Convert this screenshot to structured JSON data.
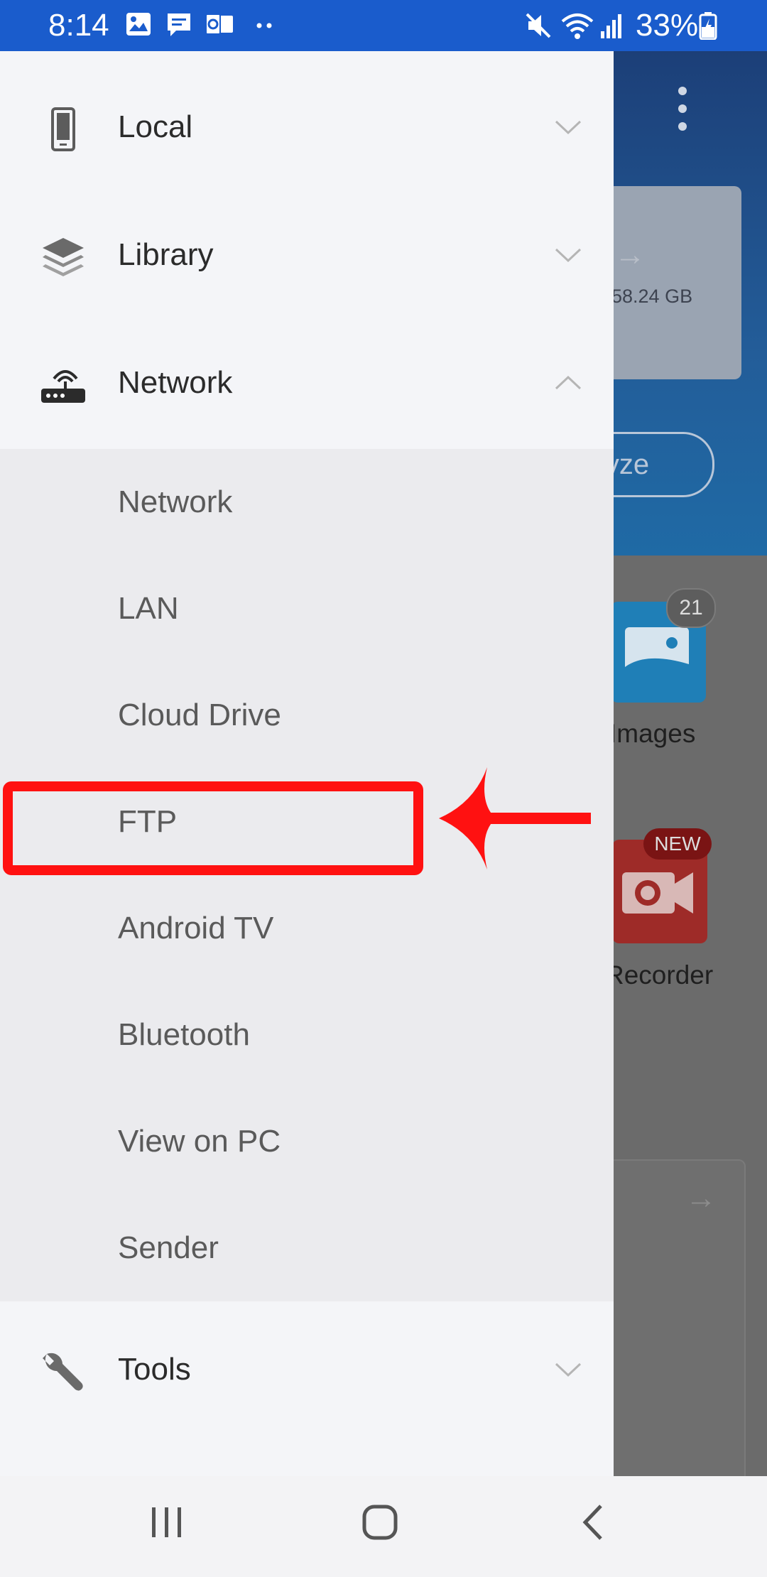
{
  "status_bar": {
    "time": "8:14",
    "battery": "33%",
    "icons": [
      "image-icon",
      "message-icon",
      "outlook-icon",
      "dots-icon",
      "mute-icon",
      "wifi-icon",
      "signal-icon",
      "battery-icon"
    ]
  },
  "drawer": {
    "items": [
      {
        "label": "Local",
        "icon": "phone-icon",
        "expanded": false
      },
      {
        "label": "Library",
        "icon": "layers-icon",
        "expanded": false
      },
      {
        "label": "Network",
        "icon": "router-icon",
        "expanded": true
      },
      {
        "label": "Tools",
        "icon": "wrench-icon",
        "expanded": false
      }
    ],
    "network_subitems": [
      "Network",
      "LAN",
      "Cloud Drive",
      "FTP",
      "Android TV",
      "Bluetooth",
      "View on PC",
      "Sender"
    ]
  },
  "annotation": {
    "highlight_target": "FTP",
    "color": "#ff1111"
  },
  "background_app": {
    "storage_text": "/ 58.24 GB",
    "analyze_button": "lyze",
    "images_badge": "21",
    "images_label": "Images",
    "new_badge": "NEW",
    "recorder_label": "Recorder"
  },
  "nav_bar": {
    "buttons": [
      "recents-icon",
      "home-icon",
      "back-icon"
    ]
  },
  "colors": {
    "status_bar": "#1a5ccc",
    "drawer_bg": "#f4f5f8",
    "submenu_bg": "#ebebee",
    "header_blue": "#235d99"
  }
}
